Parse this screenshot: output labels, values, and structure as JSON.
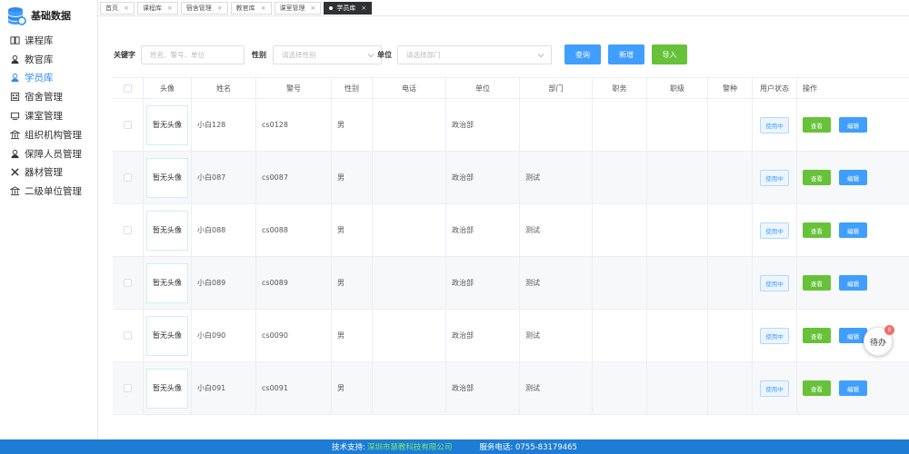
{
  "sidebar": {
    "title": "基础数据",
    "items": [
      {
        "label": "课程库",
        "icon": "book-icon"
      },
      {
        "label": "教官库",
        "icon": "user-icon"
      },
      {
        "label": "学员库",
        "icon": "user-icon",
        "active": true
      },
      {
        "label": "宿舍管理",
        "icon": "building-icon"
      },
      {
        "label": "课室管理",
        "icon": "classroom-icon"
      },
      {
        "label": "组织机构管理",
        "icon": "bank-icon"
      },
      {
        "label": "保障人员管理",
        "icon": "user-icon"
      },
      {
        "label": "器材管理",
        "icon": "tools-icon"
      },
      {
        "label": "二级单位管理",
        "icon": "bank-icon"
      }
    ]
  },
  "tabs": [
    {
      "label": "首页"
    },
    {
      "label": "课程库"
    },
    {
      "label": "宿舍管理"
    },
    {
      "label": "教官库"
    },
    {
      "label": "课室管理"
    },
    {
      "label": "学员库",
      "active": true
    }
  ],
  "filters": {
    "keyword_label": "关键字",
    "keyword_placeholder": "姓名、警号、单位",
    "gender_label": "性别",
    "gender_placeholder": "请选择性别",
    "unit_label": "单位",
    "unit_placeholder": "请选择部门",
    "search_label": "查询",
    "add_label": "新增",
    "import_label": "导入"
  },
  "table": {
    "columns": [
      "头像",
      "姓名",
      "警号",
      "性别",
      "电话",
      "单位",
      "部门",
      "职务",
      "职级",
      "警种",
      "用户状态",
      "操作"
    ],
    "rows": [
      {
        "avatar": "暂无头像",
        "name": "小白128",
        "badge": "cs0128",
        "gender": "男",
        "phone": "",
        "unit": "政治部",
        "dept": "",
        "post": "",
        "rank": "",
        "police_type": "",
        "status": "使用中"
      },
      {
        "avatar": "暂无头像",
        "name": "小白087",
        "badge": "cs0087",
        "gender": "男",
        "phone": "",
        "unit": "政治部",
        "dept": "测试",
        "post": "",
        "rank": "",
        "police_type": "",
        "status": "使用中"
      },
      {
        "avatar": "暂无头像",
        "name": "小白088",
        "badge": "cs0088",
        "gender": "男",
        "phone": "",
        "unit": "政治部",
        "dept": "测试",
        "post": "",
        "rank": "",
        "police_type": "",
        "status": "使用中"
      },
      {
        "avatar": "暂无头像",
        "name": "小白089",
        "badge": "cs0089",
        "gender": "男",
        "phone": "",
        "unit": "政治部",
        "dept": "测试",
        "post": "",
        "rank": "",
        "police_type": "",
        "status": "使用中"
      },
      {
        "avatar": "暂无头像",
        "name": "小白090",
        "badge": "cs0090",
        "gender": "男",
        "phone": "",
        "unit": "政治部",
        "dept": "测试",
        "post": "",
        "rank": "",
        "police_type": "",
        "status": "使用中"
      },
      {
        "avatar": "暂无头像",
        "name": "小白091",
        "badge": "cs0091",
        "gender": "男",
        "phone": "",
        "unit": "政治部",
        "dept": "测试",
        "post": "",
        "rank": "",
        "police_type": "",
        "status": "使用中"
      }
    ],
    "view_label": "查看",
    "edit_label": "编辑"
  },
  "footer": {
    "support_label": "技术支持:",
    "company": "深圳市慧教科技有限公司",
    "phone_label": "服务电话: 0755-83179465"
  },
  "float_widget": {
    "label": "待办",
    "badge": "0"
  },
  "colors": {
    "primary": "#409eff",
    "success": "#67c23a",
    "footer_bg": "#1e7cd4",
    "active_tab": "#303133"
  }
}
